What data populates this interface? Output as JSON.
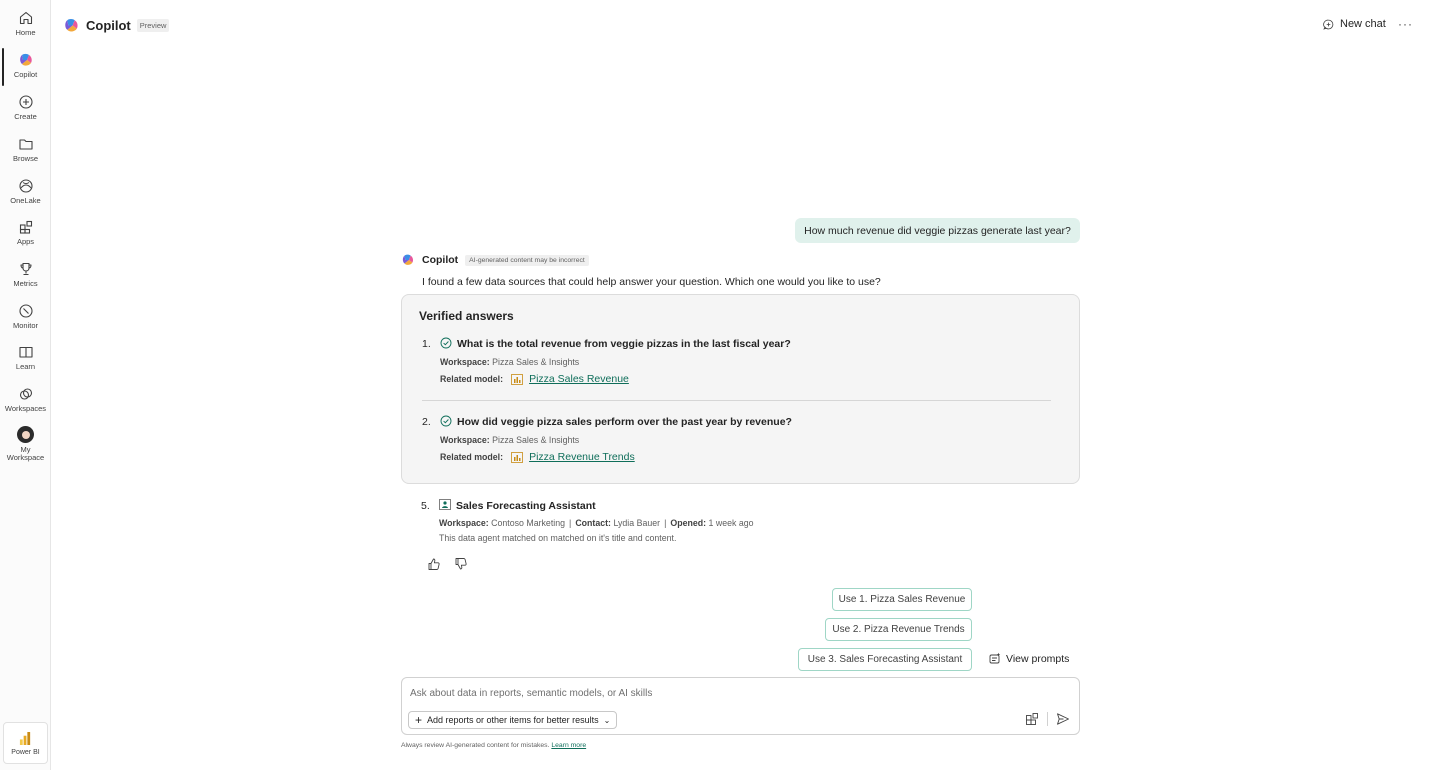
{
  "rail": {
    "items": [
      {
        "label": "Home",
        "icon": "home-icon"
      },
      {
        "label": "Copilot",
        "icon": "copilot-icon"
      },
      {
        "label": "Create",
        "icon": "plus-circle-icon"
      },
      {
        "label": "Browse",
        "icon": "folder-icon"
      },
      {
        "label": "OneLake",
        "icon": "onelake-icon"
      },
      {
        "label": "Apps",
        "icon": "apps-icon"
      },
      {
        "label": "Metrics",
        "icon": "trophy-icon"
      },
      {
        "label": "Monitor",
        "icon": "monitor-icon"
      },
      {
        "label": "Learn",
        "icon": "book-icon"
      },
      {
        "label": "Workspaces",
        "icon": "workspaces-icon"
      },
      {
        "label": "My Workspace",
        "icon": "avatar-icon"
      }
    ],
    "active": "Copilot",
    "footer_label": "Power BI"
  },
  "header": {
    "title": "Copilot",
    "badge": "Preview",
    "new_chat": "New chat",
    "more": "···"
  },
  "chat": {
    "user_message": "How much revenue did veggie pizzas generate last year?",
    "bot_name": "Copilot",
    "ai_badge": "AI-generated content may be incorrect",
    "intro": "I found a few data sources that could help answer your question. Which one would you like to use?",
    "verified": {
      "title": "Verified answers",
      "workspace_label": "Workspace:",
      "related_label": "Related model:",
      "answers": [
        {
          "num": "1.",
          "question": "What is the total revenue from veggie pizzas in the last fiscal year?",
          "workspace": "Pizza Sales & Insights",
          "model": "Pizza Sales Revenue"
        },
        {
          "num": "2.",
          "question": "How did veggie pizza sales perform over the past year by revenue?",
          "workspace": "Pizza Sales & Insights",
          "model": "Pizza Revenue Trends"
        }
      ]
    },
    "agent": {
      "num": "5.",
      "name": "Sales Forecasting Assistant",
      "workspace_label": "Workspace:",
      "workspace": "Contoso Marketing",
      "contact_label": "Contact:",
      "contact": "Lydia Bauer",
      "opened_label": "Opened:",
      "opened": "1 week ago",
      "description": "This data agent matched on matched on it's title and content."
    },
    "suggestions": [
      "Use 1. Pizza Sales Revenue",
      "Use 2. Pizza Revenue Trends",
      "Use 3. Sales Forecasting Assistant"
    ],
    "view_prompts": "View prompts"
  },
  "composer": {
    "placeholder": "Ask about data in reports, semantic models, or AI skills",
    "add_label": "Add reports or other items for better results"
  },
  "disclaimer": {
    "text": "Always review AI-generated content for mistakes.",
    "link": "Learn more"
  },
  "colors": {
    "accent": "#0f6e5a",
    "user_bubble": "#e0f1ec",
    "suggestion_border": "#9fd6c6"
  }
}
